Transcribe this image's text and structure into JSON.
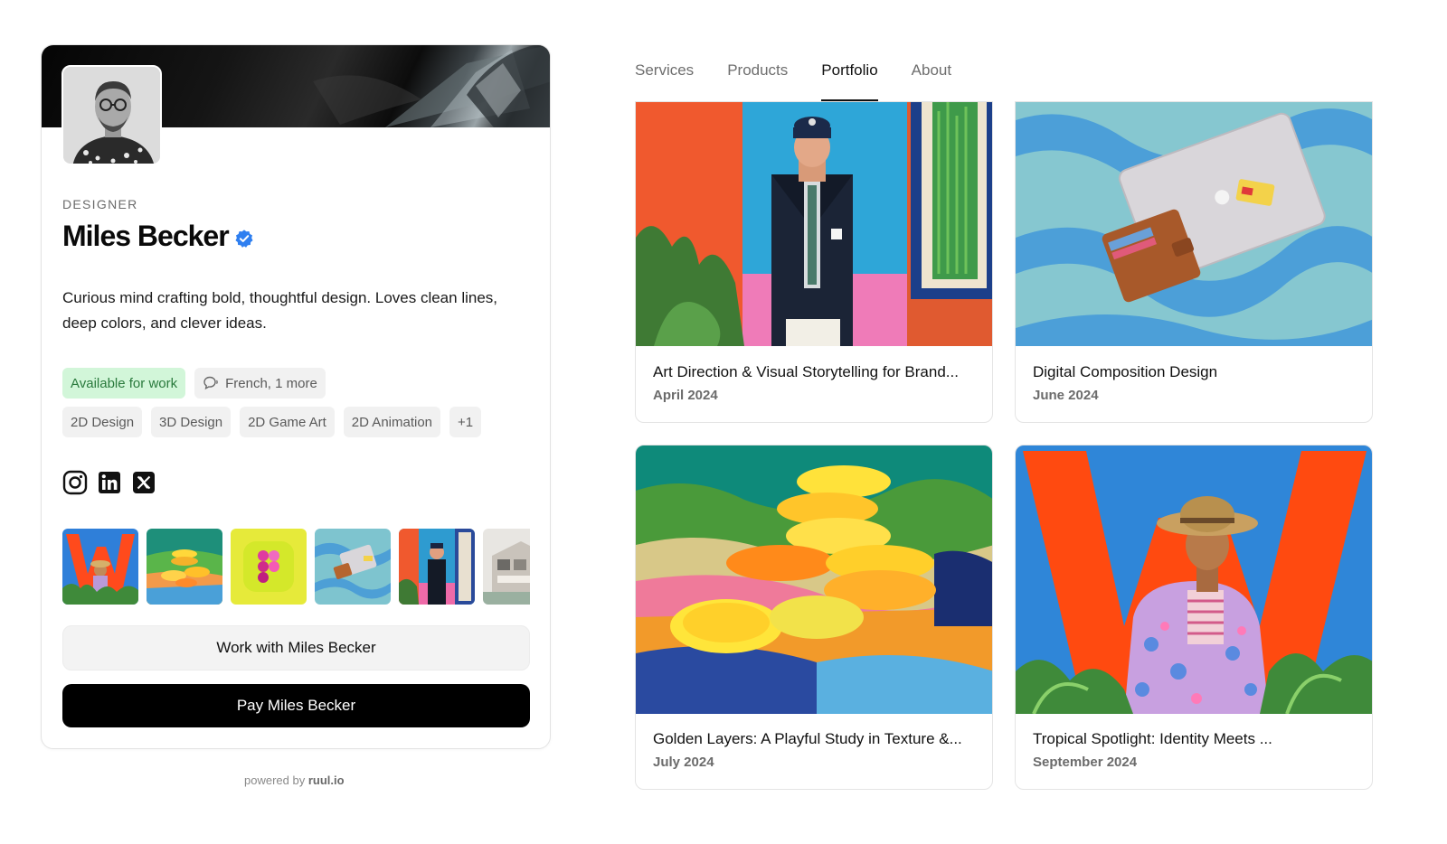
{
  "profile": {
    "role": "DESIGNER",
    "name": "Miles Becker",
    "bio": "Curious mind crafting bold, thoughtful design. Loves clean lines, deep colors, and clever ideas.",
    "availability": "Available for work",
    "languages": "French, 1 more",
    "skills": [
      "2D Design",
      "3D Design",
      "2D Game Art",
      "2D Animation",
      "+1"
    ],
    "socials": [
      "instagram-icon",
      "linkedin-icon",
      "x-icon"
    ],
    "work_button": "Work with Miles Becker",
    "pay_button": "Pay Miles Becker"
  },
  "footer": {
    "powered_prefix": "powered by",
    "powered_brand": "ruul.io"
  },
  "tabs": [
    {
      "label": "Services",
      "active": false
    },
    {
      "label": "Products",
      "active": false
    },
    {
      "label": "Portfolio",
      "active": true
    },
    {
      "label": "About",
      "active": false
    }
  ],
  "portfolio": [
    {
      "title": "Art Direction & Visual Storytelling for Brand...",
      "date": "April 2024"
    },
    {
      "title": "Digital Composition Design",
      "date": "June 2024"
    },
    {
      "title": "Golden Layers: A Playful Study in Texture &...",
      "date": "July 2024"
    },
    {
      "title": "Tropical Spotlight: Identity Meets ...",
      "date": "September 2024"
    }
  ],
  "colors": {
    "available_bg": "#d2f6d9",
    "available_text": "#2a7a3d",
    "verified": "#2f7ff0",
    "pay_bg": "#000000"
  }
}
